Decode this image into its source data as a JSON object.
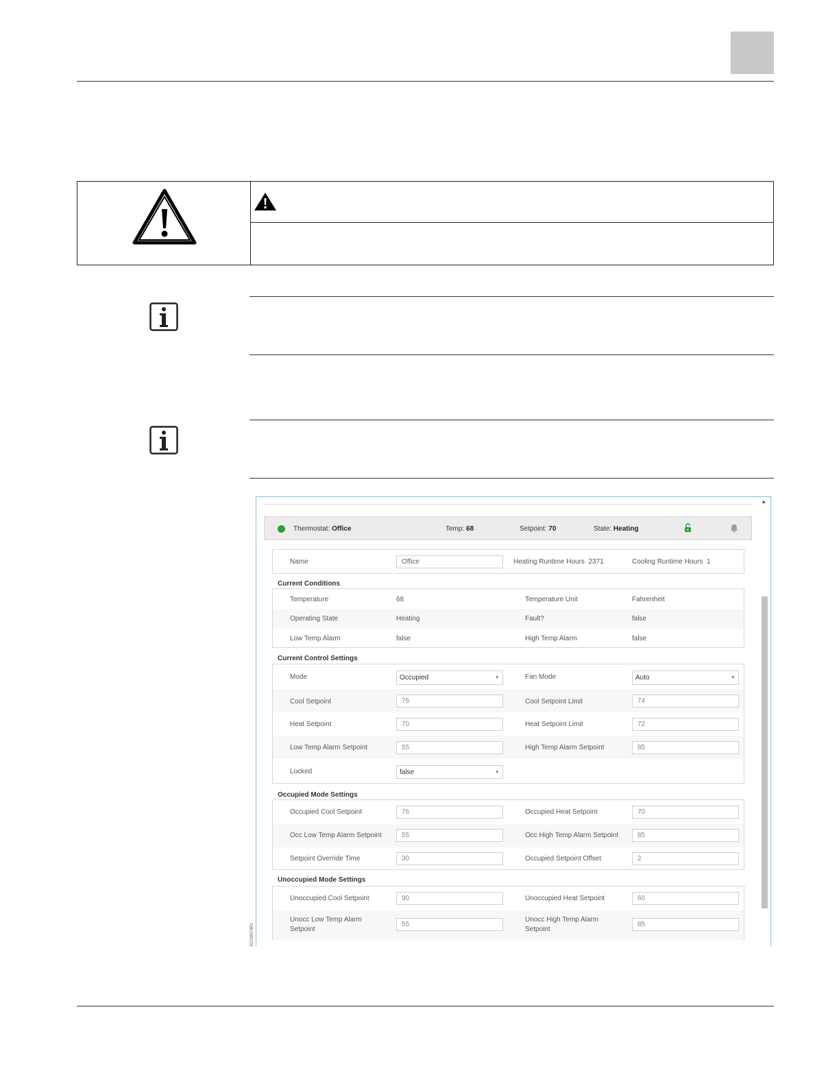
{
  "warning": {
    "icon": "warning-triangle-icon",
    "small_icon": "warning-small-icon"
  },
  "notes": [
    {
      "icon": "info-icon"
    },
    {
      "icon": "info-icon"
    }
  ],
  "figure_code": "ECO0074R1",
  "app": {
    "header": {
      "thermostat_label": "Thermostat:",
      "thermostat_name": "Office",
      "temp_label": "Temp:",
      "temp_value": "68",
      "setpoint_label": "Setpoint:",
      "setpoint_value": "70",
      "state_label": "State:",
      "state_value": "Heating",
      "status_color": "#2e9e3a",
      "lock_icon": "unlock-icon",
      "bell_icon": "bell-icon"
    },
    "top": {
      "name_label": "Name",
      "name_value": "Office",
      "heating_runtime_label": "Heating Runtime Hours",
      "heating_runtime_value": "2371",
      "cooling_runtime_label": "Cooling Runtime Hours",
      "cooling_runtime_value": "1"
    },
    "current_conditions": {
      "title": "Current Conditions",
      "rows": [
        {
          "l1": "Temperature",
          "v1": "68",
          "l2": "Temperature Unit",
          "v2": "Fahrenheit"
        },
        {
          "l1": "Operating State",
          "v1": "Heating",
          "l2": "Fault?",
          "v2": "false"
        },
        {
          "l1": "Low Temp Alarm",
          "v1": "false",
          "l2": "High Temp Alarm",
          "v2": "false"
        }
      ]
    },
    "control": {
      "title": "Current Control Settings",
      "mode_label": "Mode",
      "mode_value": "Occupied",
      "fan_mode_label": "Fan Mode",
      "fan_mode_value": "Auto",
      "cool_setpoint_label": "Cool Setpoint",
      "cool_setpoint_value": "76",
      "cool_limit_label": "Cool Setpoint Limit",
      "cool_limit_value": "74",
      "heat_setpoint_label": "Heat Setpoint",
      "heat_setpoint_value": "70",
      "heat_limit_label": "Heat Setpoint Limit",
      "heat_limit_value": "72",
      "low_alarm_label": "Low Temp Alarm Setpoint",
      "low_alarm_value": "55",
      "high_alarm_label": "High Temp Alarm Setpoint",
      "high_alarm_value": "85",
      "locked_label": "Locked",
      "locked_value": "false"
    },
    "occupied": {
      "title": "Occupied Mode Settings",
      "cool_label": "Occupied Cool Setpoint",
      "cool_value": "76",
      "heat_label": "Occupied Heat Setpoint",
      "heat_value": "70",
      "low_label": "Occ Low Temp Alarm Setpoint",
      "low_value": "55",
      "high_label": "Occ High Temp Alarm Setpoint",
      "high_value": "85",
      "override_label": "Setpoint Override Time",
      "override_value": "30",
      "offset_label": "Occupied Setpoint Offset",
      "offset_value": "2"
    },
    "unoccupied": {
      "title": "Unoccupied Mode Settings",
      "cool_label": "Unoccupied Cool Setpoint",
      "cool_value": "90",
      "heat_label": "Unoccupied Heat Setpoint",
      "heat_value": "60",
      "low_label_1": "Unocc Low Temp Alarm",
      "low_label_2": "Setpoint",
      "low_value": "55",
      "high_label_1": "Unocc High Temp Alarm",
      "high_label_2": "Setpoint",
      "high_value": "85"
    }
  }
}
